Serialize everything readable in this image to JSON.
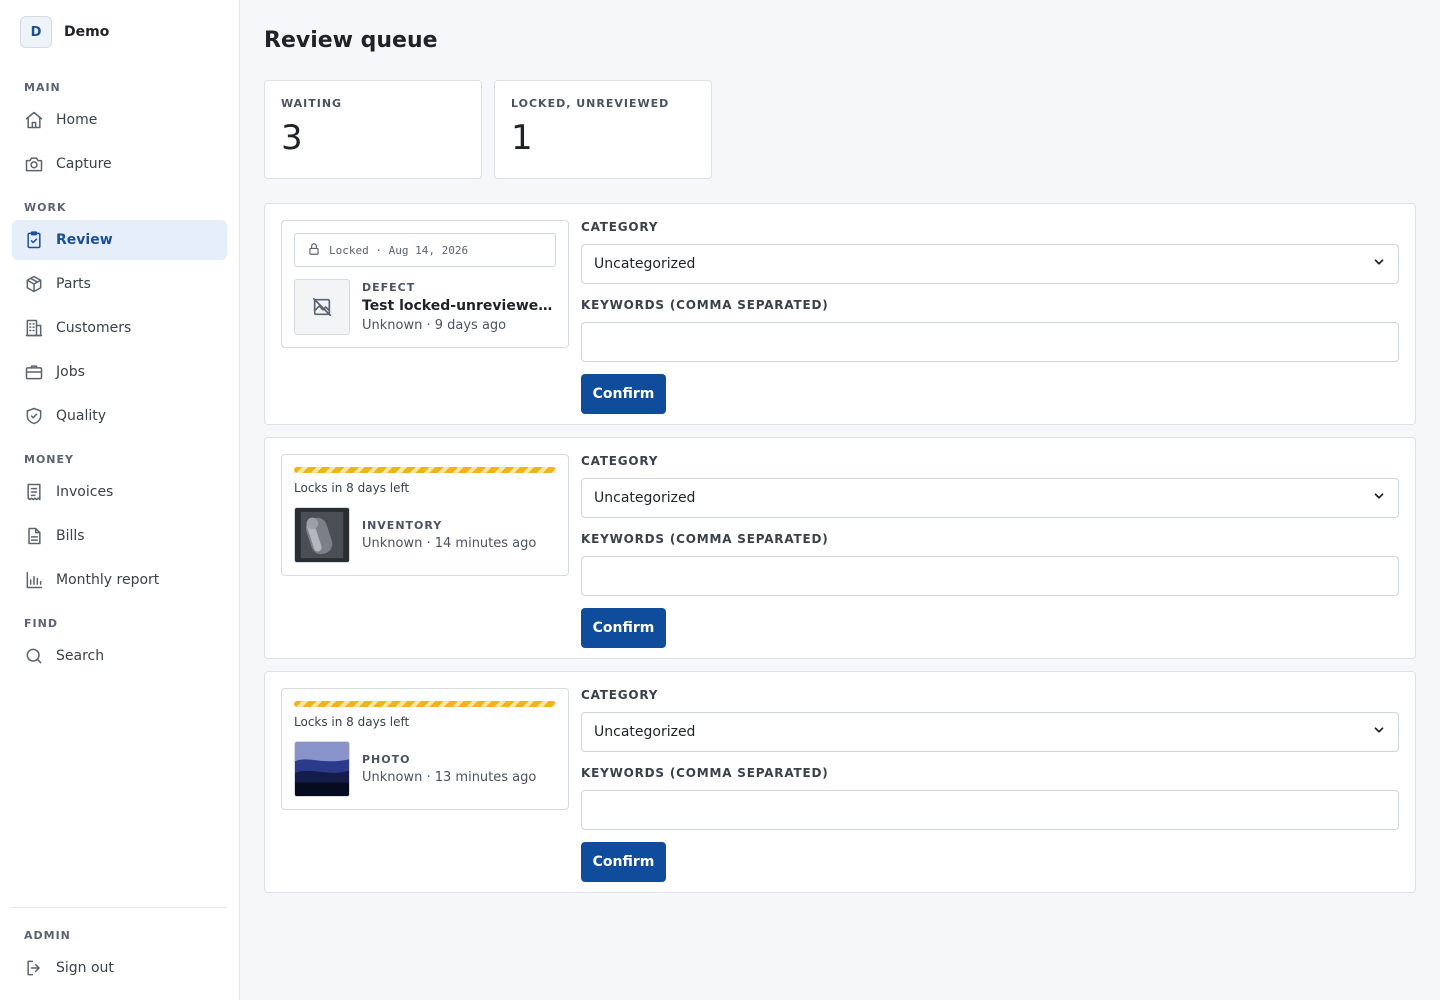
{
  "brand": {
    "badge": "D",
    "name": "Demo"
  },
  "sidebar": {
    "sections": [
      {
        "label": "MAIN",
        "items": [
          {
            "label": "Home",
            "icon": "home-icon"
          },
          {
            "label": "Capture",
            "icon": "camera-icon"
          }
        ]
      },
      {
        "label": "WORK",
        "items": [
          {
            "label": "Review",
            "icon": "clipboard-check-icon",
            "active": true
          },
          {
            "label": "Parts",
            "icon": "box-icon"
          },
          {
            "label": "Customers",
            "icon": "building-icon"
          },
          {
            "label": "Jobs",
            "icon": "briefcase-icon"
          },
          {
            "label": "Quality",
            "icon": "shield-check-icon"
          }
        ]
      },
      {
        "label": "MONEY",
        "items": [
          {
            "label": "Invoices",
            "icon": "receipt-icon"
          },
          {
            "label": "Bills",
            "icon": "document-icon"
          },
          {
            "label": "Monthly report",
            "icon": "bar-chart-icon"
          }
        ]
      },
      {
        "label": "FIND",
        "items": [
          {
            "label": "Search",
            "icon": "search-icon"
          }
        ]
      }
    ],
    "admin": {
      "label": "ADMIN",
      "signout": "Sign out"
    }
  },
  "page": {
    "title": "Review queue"
  },
  "stats": [
    {
      "label": "WAITING",
      "value": "3"
    },
    {
      "label": "LOCKED, UNREVIEWED",
      "value": "1"
    }
  ],
  "queue": [
    {
      "locked": true,
      "lock_text": "Locked · Aug 14, 2026",
      "kind": "DEFECT",
      "title": "Test locked-unreviewed ex…",
      "sub": "Unknown · 9 days ago",
      "thumb": "no-image-icon",
      "category_label": "CATEGORY",
      "category_value": "Uncategorized",
      "keywords_label": "KEYWORDS (COMMA SEPARATED)",
      "keywords_value": "",
      "confirm": "Confirm"
    },
    {
      "locked": false,
      "lock_text": "Locks in 8 days left",
      "kind": "INVENTORY",
      "title": "",
      "sub": "Unknown · 14 minutes ago",
      "thumb": "inventory-photo",
      "category_label": "CATEGORY",
      "category_value": "Uncategorized",
      "keywords_label": "KEYWORDS (COMMA SEPARATED)",
      "keywords_value": "",
      "confirm": "Confirm"
    },
    {
      "locked": false,
      "lock_text": "Locks in 8 days left",
      "kind": "PHOTO",
      "title": "",
      "sub": "Unknown · 13 minutes ago",
      "thumb": "landscape-photo",
      "category_label": "CATEGORY",
      "category_value": "Uncategorized",
      "keywords_label": "KEYWORDS (COMMA SEPARATED)",
      "keywords_value": "",
      "confirm": "Confirm"
    }
  ],
  "colors": {
    "accent": "#0f4c9c",
    "active_bg": "#e6eef9",
    "warning_stripe": "#f2b21c"
  }
}
